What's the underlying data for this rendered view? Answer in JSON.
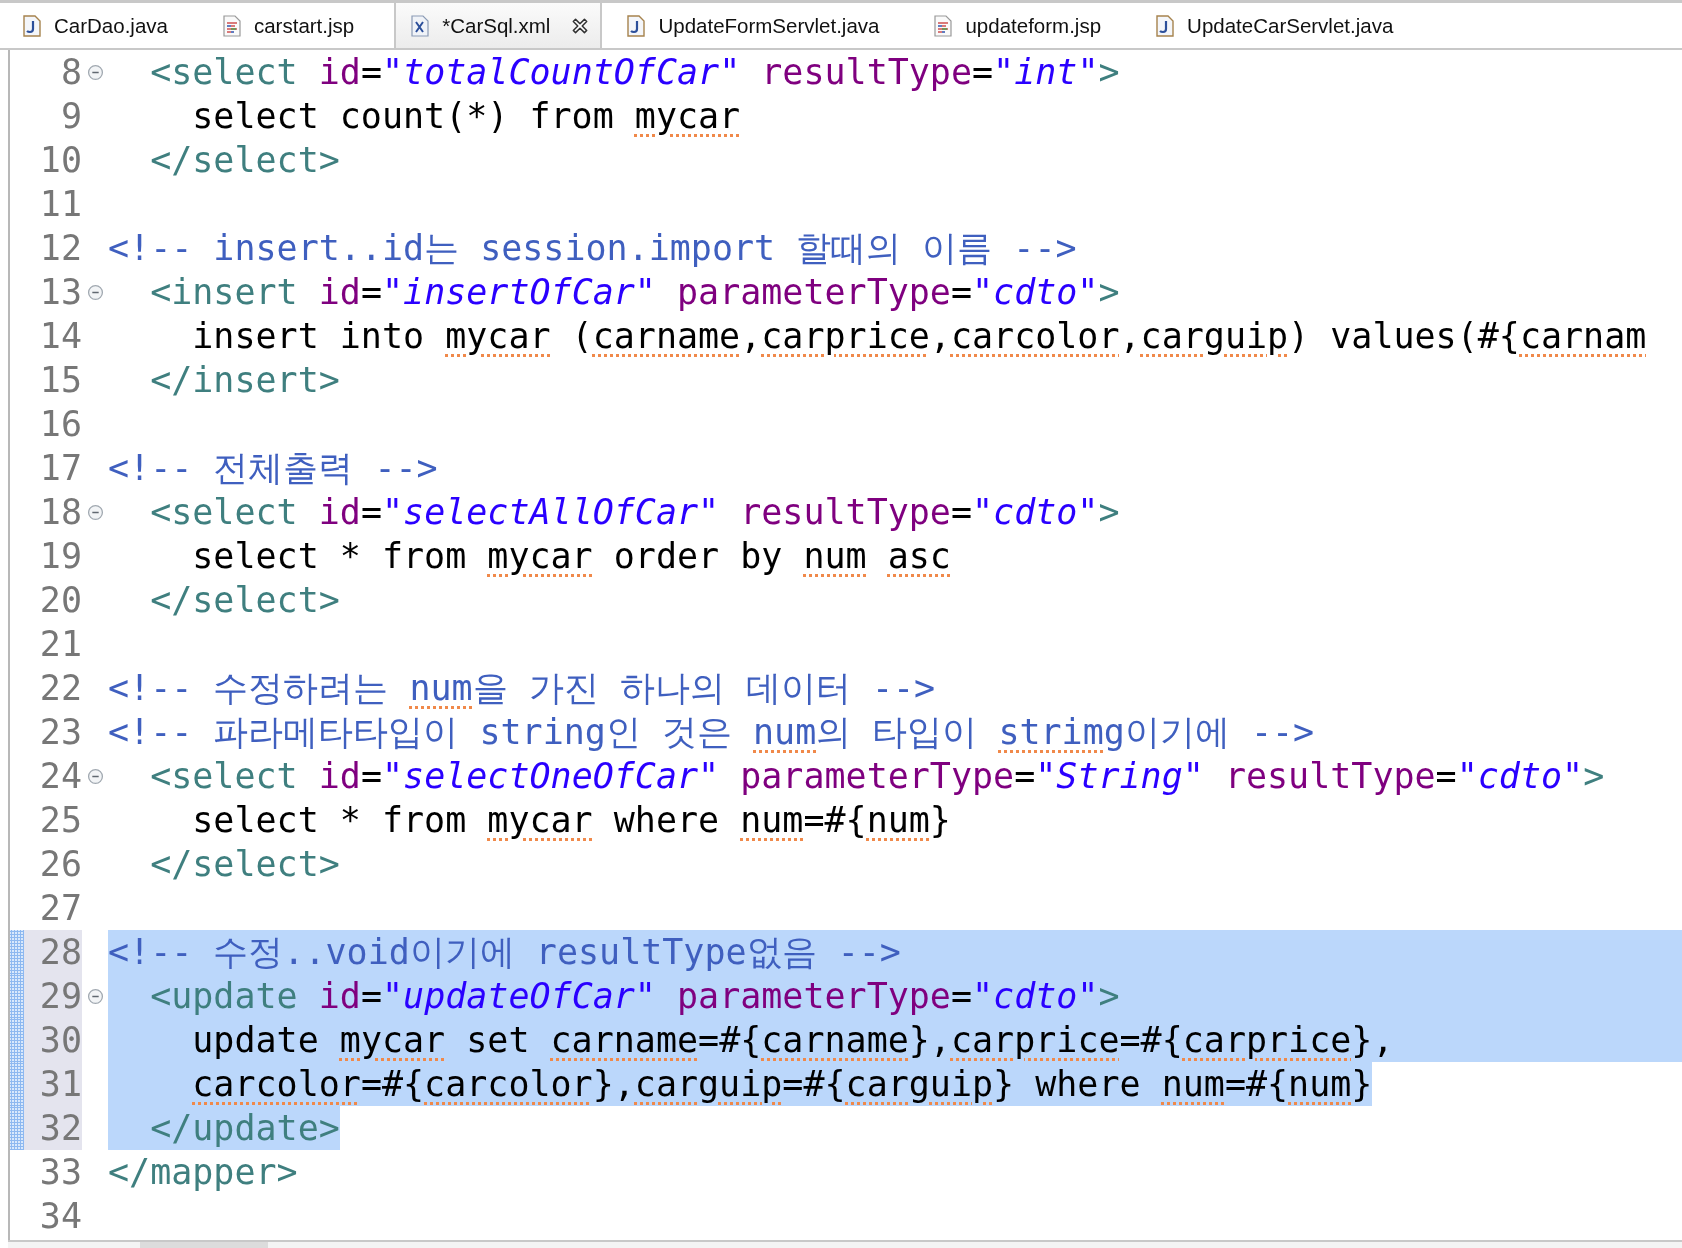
{
  "tabs": [
    {
      "label": "CarDao.java",
      "kind": "java",
      "selected": false
    },
    {
      "label": "carstart.jsp",
      "kind": "jsp",
      "selected": false
    },
    {
      "label": "*CarSql.xml",
      "kind": "xml",
      "selected": true
    },
    {
      "label": "UpdateFormServlet.java",
      "kind": "java",
      "selected": false
    },
    {
      "label": "updateform.jsp",
      "kind": "jsp",
      "selected": false
    },
    {
      "label": "UpdateCarServlet.java",
      "kind": "java",
      "selected": false
    }
  ],
  "editor": {
    "lines": [
      {
        "number": "8",
        "fold": true,
        "selected": false,
        "to_edge": false,
        "tokens": [
          {
            "kind": "tag",
            "text": "  <select",
            "squiggle": false
          },
          {
            "kind": "attr",
            "text": " id",
            "squiggle": false
          },
          {
            "kind": "plain",
            "text": "=",
            "squiggle": false
          },
          {
            "kind": "value",
            "text": "\"totalCountOfCar\"",
            "squiggle": false
          },
          {
            "kind": "attr",
            "text": " resultType",
            "squiggle": false
          },
          {
            "kind": "plain",
            "text": "=",
            "squiggle": false
          },
          {
            "kind": "value",
            "text": "\"int\"",
            "squiggle": false
          },
          {
            "kind": "tag",
            "text": ">",
            "squiggle": false
          }
        ]
      },
      {
        "number": "9",
        "fold": false,
        "selected": false,
        "to_edge": false,
        "tokens": [
          {
            "kind": "plain",
            "text": "    select count(*) from",
            "squiggle": false
          },
          {
            "kind": "plain",
            "text": " mycar",
            "squiggle": true
          }
        ]
      },
      {
        "number": "10",
        "fold": false,
        "selected": false,
        "to_edge": false,
        "tokens": [
          {
            "kind": "tag",
            "text": "  </select>",
            "squiggle": false
          }
        ]
      },
      {
        "number": "11",
        "fold": false,
        "selected": false,
        "to_edge": false
      },
      {
        "number": "12",
        "fold": false,
        "selected": false,
        "to_edge": false,
        "tokens": [
          {
            "kind": "comment",
            "text": "<!-- insert..id는 session.import 할때의 이름 -->",
            "squiggle": false
          }
        ]
      },
      {
        "number": "13",
        "fold": true,
        "selected": false,
        "to_edge": false,
        "tokens": [
          {
            "kind": "tag",
            "text": "  <insert",
            "squiggle": false
          },
          {
            "kind": "attr",
            "text": " id",
            "squiggle": false
          },
          {
            "kind": "plain",
            "text": "=",
            "squiggle": false
          },
          {
            "kind": "value",
            "text": "\"insertOfCar\"",
            "squiggle": false
          },
          {
            "kind": "attr",
            "text": " parameterType",
            "squiggle": false
          },
          {
            "kind": "plain",
            "text": "=",
            "squiggle": false
          },
          {
            "kind": "value",
            "text": "\"cdto\"",
            "squiggle": false
          },
          {
            "kind": "tag",
            "text": ">",
            "squiggle": false
          }
        ]
      },
      {
        "number": "14",
        "fold": false,
        "selected": false,
        "to_edge": false,
        "tokens": [
          {
            "kind": "plain",
            "text": "    insert into",
            "squiggle": false
          },
          {
            "kind": "plain",
            "text": " mycar",
            "squiggle": true
          },
          {
            "kind": "plain",
            "text": " (",
            "squiggle": false
          },
          {
            "kind": "plain",
            "text": "carname",
            "squiggle": true
          },
          {
            "kind": "plain",
            "text": ",",
            "squiggle": false
          },
          {
            "kind": "plain",
            "text": "carprice",
            "squiggle": true
          },
          {
            "kind": "plain",
            "text": ",",
            "squiggle": false
          },
          {
            "kind": "plain",
            "text": "carcolor",
            "squiggle": true
          },
          {
            "kind": "plain",
            "text": ",",
            "squiggle": false
          },
          {
            "kind": "plain",
            "text": "carguip",
            "squiggle": true
          },
          {
            "kind": "plain",
            "text": ") values(#{",
            "squiggle": false
          },
          {
            "kind": "plain",
            "text": "carnam",
            "squiggle": true
          }
        ]
      },
      {
        "number": "15",
        "fold": false,
        "selected": false,
        "to_edge": false,
        "tokens": [
          {
            "kind": "tag",
            "text": "  </insert>",
            "squiggle": false
          }
        ]
      },
      {
        "number": "16",
        "fold": false,
        "selected": false,
        "to_edge": false
      },
      {
        "number": "17",
        "fold": false,
        "selected": false,
        "to_edge": false,
        "tokens": [
          {
            "kind": "comment",
            "text": "<!-- 전체출력 -->",
            "squiggle": false
          }
        ]
      },
      {
        "number": "18",
        "fold": true,
        "selected": false,
        "to_edge": false,
        "tokens": [
          {
            "kind": "tag",
            "text": "  <select",
            "squiggle": false
          },
          {
            "kind": "attr",
            "text": " id",
            "squiggle": false
          },
          {
            "kind": "plain",
            "text": "=",
            "squiggle": false
          },
          {
            "kind": "value",
            "text": "\"selectAllOfCar\"",
            "squiggle": false
          },
          {
            "kind": "attr",
            "text": " resultType",
            "squiggle": false
          },
          {
            "kind": "plain",
            "text": "=",
            "squiggle": false
          },
          {
            "kind": "value",
            "text": "\"cdto\"",
            "squiggle": false
          },
          {
            "kind": "tag",
            "text": ">",
            "squiggle": false
          }
        ]
      },
      {
        "number": "19",
        "fold": false,
        "selected": false,
        "to_edge": false,
        "tokens": [
          {
            "kind": "plain",
            "text": "    select * from",
            "squiggle": false
          },
          {
            "kind": "plain",
            "text": " mycar",
            "squiggle": true
          },
          {
            "kind": "plain",
            "text": " order by",
            "squiggle": false
          },
          {
            "kind": "plain",
            "text": " num",
            "squiggle": true
          },
          {
            "kind": "plain",
            "text": " asc",
            "squiggle": true
          }
        ]
      },
      {
        "number": "20",
        "fold": false,
        "selected": false,
        "to_edge": false,
        "tokens": [
          {
            "kind": "tag",
            "text": "  </select>",
            "squiggle": false
          }
        ]
      },
      {
        "number": "21",
        "fold": false,
        "selected": false,
        "to_edge": false
      },
      {
        "number": "22",
        "fold": false,
        "selected": false,
        "to_edge": false,
        "tokens": [
          {
            "kind": "comment",
            "text": "<!-- 수정하려는",
            "squiggle": false
          },
          {
            "kind": "comment",
            "text": " num",
            "squiggle": true
          },
          {
            "kind": "comment",
            "text": "을 가진 하나의 데이터 -->",
            "squiggle": false
          }
        ]
      },
      {
        "number": "23",
        "fold": false,
        "selected": false,
        "to_edge": false,
        "tokens": [
          {
            "kind": "comment",
            "text": "<!-- 파라메타타입이 string인 것은",
            "squiggle": false
          },
          {
            "kind": "comment",
            "text": " num",
            "squiggle": true
          },
          {
            "kind": "comment",
            "text": "의 타입이",
            "squiggle": false
          },
          {
            "kind": "comment",
            "text": " strimg",
            "squiggle": true
          },
          {
            "kind": "comment",
            "text": "이기에 -->",
            "squiggle": false
          }
        ]
      },
      {
        "number": "24",
        "fold": true,
        "selected": false,
        "to_edge": false,
        "tokens": [
          {
            "kind": "tag",
            "text": "  <select",
            "squiggle": false
          },
          {
            "kind": "attr",
            "text": " id",
            "squiggle": false
          },
          {
            "kind": "plain",
            "text": "=",
            "squiggle": false
          },
          {
            "kind": "value",
            "text": "\"selectOneOfCar\"",
            "squiggle": false
          },
          {
            "kind": "attr",
            "text": " parameterType",
            "squiggle": false
          },
          {
            "kind": "plain",
            "text": "=",
            "squiggle": false
          },
          {
            "kind": "value",
            "text": "\"String\"",
            "squiggle": false
          },
          {
            "kind": "attr",
            "text": " resultType",
            "squiggle": false
          },
          {
            "kind": "plain",
            "text": "=",
            "squiggle": false
          },
          {
            "kind": "value",
            "text": "\"cdto\"",
            "squiggle": false
          },
          {
            "kind": "tag",
            "text": ">",
            "squiggle": false
          }
        ]
      },
      {
        "number": "25",
        "fold": false,
        "selected": false,
        "to_edge": false,
        "tokens": [
          {
            "kind": "plain",
            "text": "    select * from",
            "squiggle": false
          },
          {
            "kind": "plain",
            "text": " mycar",
            "squiggle": true
          },
          {
            "kind": "plain",
            "text": " where",
            "squiggle": false
          },
          {
            "kind": "plain",
            "text": " num",
            "squiggle": true
          },
          {
            "kind": "plain",
            "text": "=#{",
            "squiggle": false
          },
          {
            "kind": "plain",
            "text": "num",
            "squiggle": true
          },
          {
            "kind": "plain",
            "text": "}",
            "squiggle": false
          }
        ]
      },
      {
        "number": "26",
        "fold": false,
        "selected": false,
        "to_edge": false,
        "tokens": [
          {
            "kind": "tag",
            "text": "  </select>",
            "squiggle": false
          }
        ]
      },
      {
        "number": "27",
        "fold": false,
        "selected": false,
        "to_edge": false
      },
      {
        "number": "28",
        "fold": false,
        "selected": true,
        "to_edge": true,
        "tokens": [
          {
            "kind": "comment",
            "text": "<!-- 수정..void이기에 resultType없음 -->",
            "squiggle": false
          }
        ]
      },
      {
        "number": "29",
        "fold": true,
        "selected": true,
        "to_edge": true,
        "tokens": [
          {
            "kind": "tag",
            "text": "  <update",
            "squiggle": false
          },
          {
            "kind": "attr",
            "text": " id",
            "squiggle": false
          },
          {
            "kind": "plain",
            "text": "=",
            "squiggle": false
          },
          {
            "kind": "value",
            "text": "\"updateOfCar\"",
            "squiggle": false
          },
          {
            "kind": "attr",
            "text": " parameterType",
            "squiggle": false
          },
          {
            "kind": "plain",
            "text": "=",
            "squiggle": false
          },
          {
            "kind": "value",
            "text": "\"cdto\"",
            "squiggle": false
          },
          {
            "kind": "tag",
            "text": ">",
            "squiggle": false
          }
        ]
      },
      {
        "number": "30",
        "fold": false,
        "selected": true,
        "to_edge": true,
        "tokens": [
          {
            "kind": "plain",
            "text": "    update",
            "squiggle": false
          },
          {
            "kind": "plain",
            "text": " mycar",
            "squiggle": true
          },
          {
            "kind": "plain",
            "text": " set",
            "squiggle": false
          },
          {
            "kind": "plain",
            "text": " carname",
            "squiggle": true
          },
          {
            "kind": "plain",
            "text": "=#{",
            "squiggle": false
          },
          {
            "kind": "plain",
            "text": "carname",
            "squiggle": true
          },
          {
            "kind": "plain",
            "text": "},",
            "squiggle": false
          },
          {
            "kind": "plain",
            "text": "carprice",
            "squiggle": true
          },
          {
            "kind": "plain",
            "text": "=#{",
            "squiggle": false
          },
          {
            "kind": "plain",
            "text": "carprice",
            "squiggle": true
          },
          {
            "kind": "plain",
            "text": "},",
            "squiggle": false
          }
        ]
      },
      {
        "number": "31",
        "fold": false,
        "selected": true,
        "to_edge": false,
        "tokens": [
          {
            "kind": "plain",
            "text": "    carcolor",
            "squiggle": true
          },
          {
            "kind": "plain",
            "text": "=#{",
            "squiggle": false
          },
          {
            "kind": "plain",
            "text": "carcolor",
            "squiggle": true
          },
          {
            "kind": "plain",
            "text": "},",
            "squiggle": false
          },
          {
            "kind": "plain",
            "text": "carguip",
            "squiggle": true
          },
          {
            "kind": "plain",
            "text": "=#{",
            "squiggle": false
          },
          {
            "kind": "plain",
            "text": "carguip",
            "squiggle": true
          },
          {
            "kind": "plain",
            "text": "} where",
            "squiggle": false
          },
          {
            "kind": "plain",
            "text": " num",
            "squiggle": true
          },
          {
            "kind": "plain",
            "text": "=#{",
            "squiggle": false
          },
          {
            "kind": "plain",
            "text": "num",
            "squiggle": true
          },
          {
            "kind": "plain",
            "text": "}",
            "squiggle": false
          }
        ]
      },
      {
        "number": "32",
        "fold": false,
        "selected": true,
        "to_edge": false,
        "tokens": [
          {
            "kind": "tag",
            "text": "  </update>",
            "squiggle": false
          }
        ]
      },
      {
        "number": "33",
        "fold": false,
        "selected": false,
        "to_edge": false,
        "tokens": [
          {
            "kind": "tag",
            "text": "</mapper>",
            "squiggle": false
          }
        ]
      },
      {
        "number": "34",
        "fold": false,
        "selected": false,
        "to_edge": false
      }
    ]
  }
}
